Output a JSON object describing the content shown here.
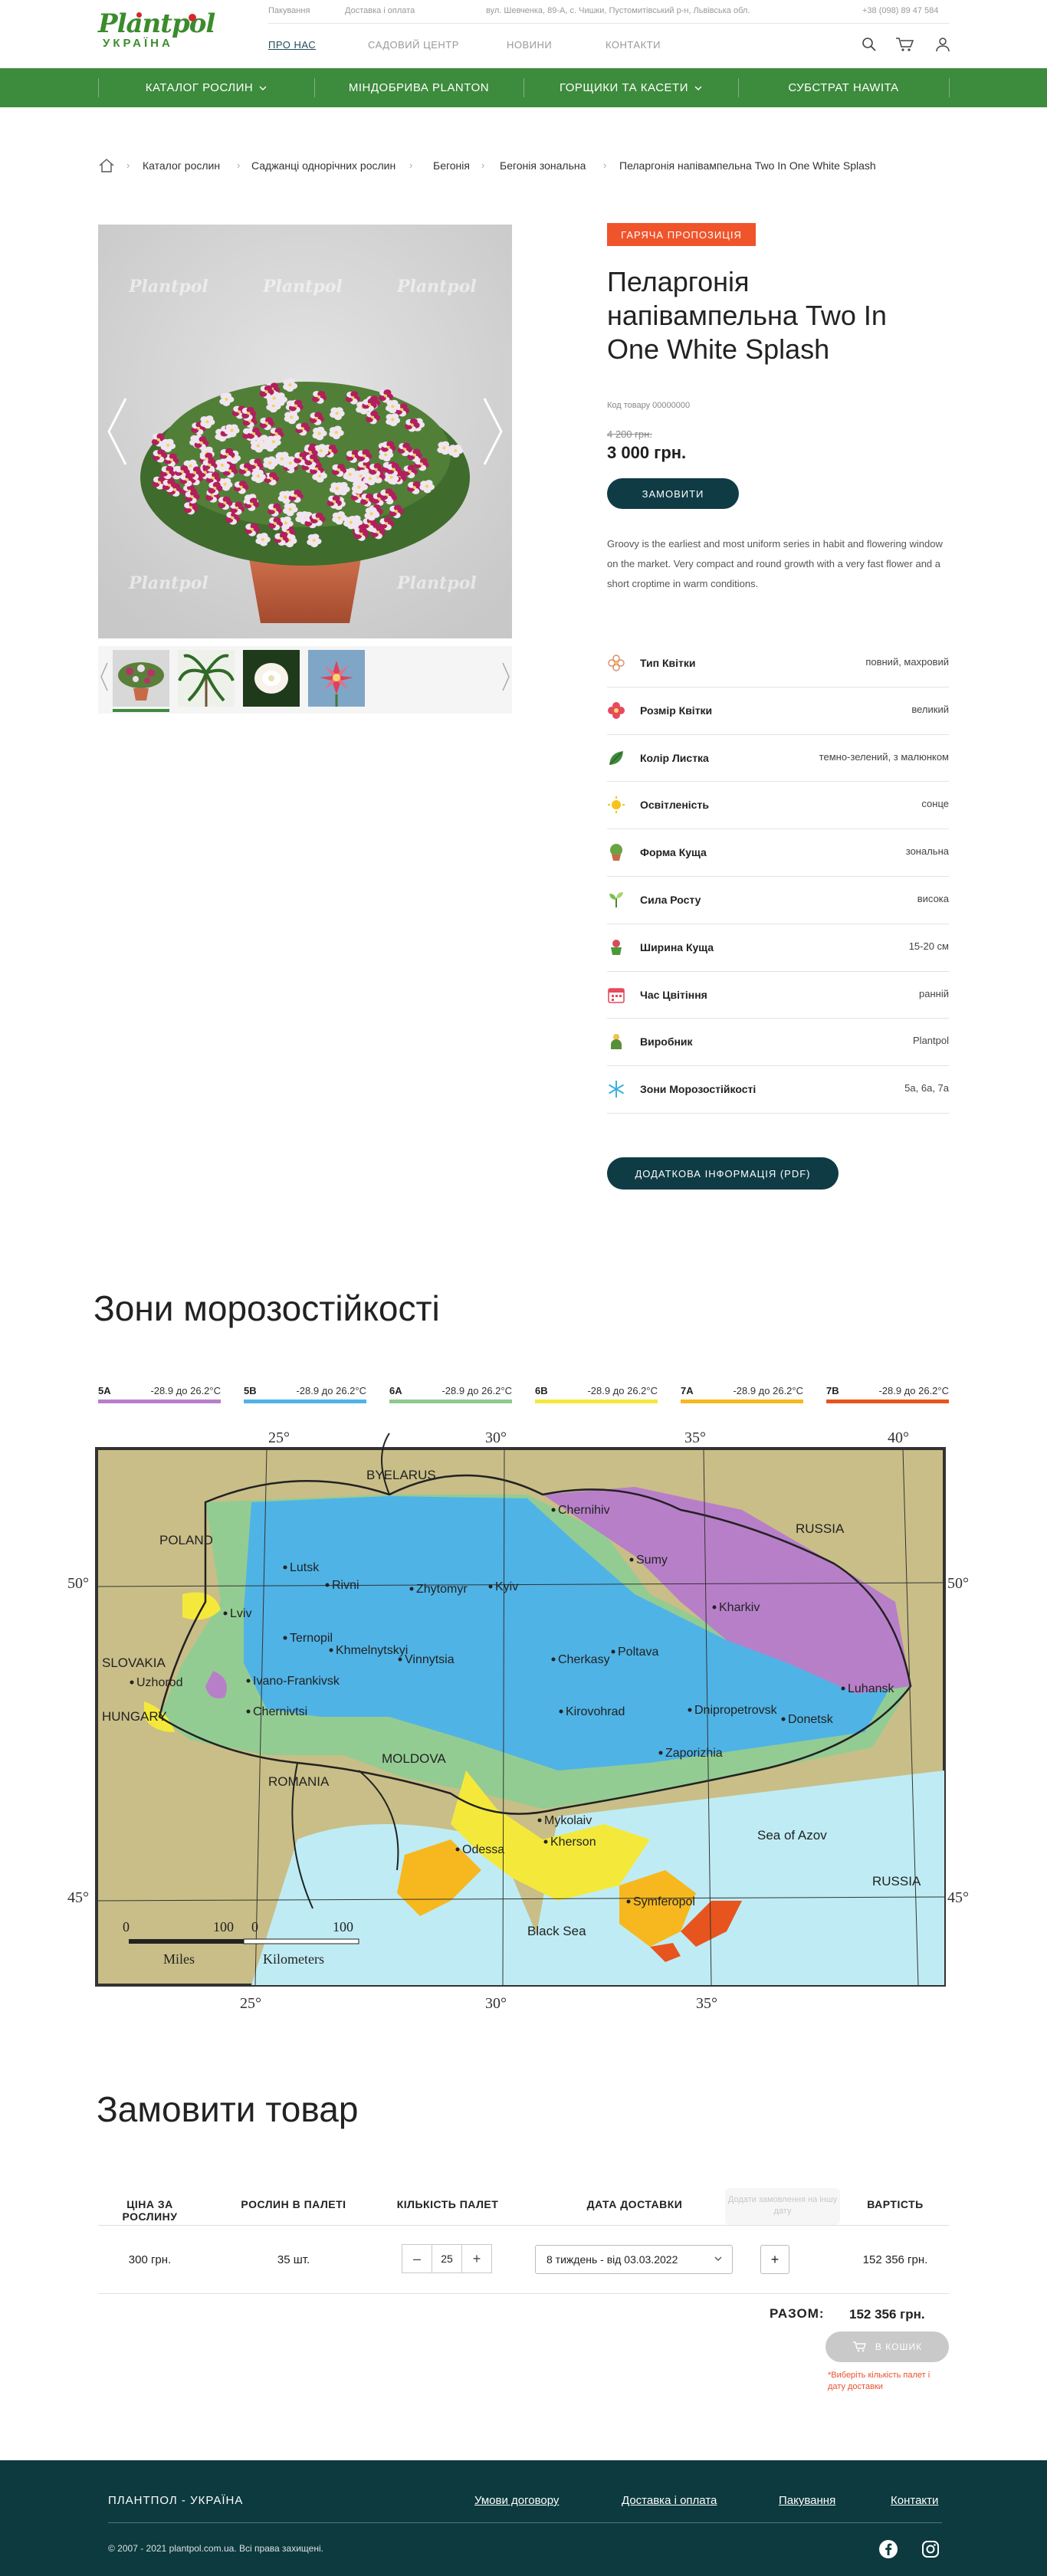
{
  "header": {
    "logo_top": "Plantpol",
    "logo_bottom": "УКРАЇНА",
    "top_links": [
      "Пакування",
      "Доставка і оплата"
    ],
    "address": "вул. Шевченка, 89-А, с. Чишки, Пустомитівський р-н, Львівська обл.",
    "phone": "+38 (098) 89 47 584",
    "main_nav": [
      "ПРО НАС",
      "САДОВИЙ ЦЕНТР",
      "НОВИНИ",
      "КОНТАКТИ"
    ],
    "icons": [
      "search-icon",
      "cart-icon",
      "user-icon"
    ]
  },
  "category_nav": [
    "КАТАЛОГ РОСЛИН",
    "МІНДОБРИВА PLANTON",
    "ГОРЩИКИ ТА КАСЕТИ",
    "СУБСТРАТ HAWITA"
  ],
  "breadcrumb": [
    "Каталог рослин",
    "Саджанці однорічних рослин",
    "Бегонія",
    "Бегонія зональна",
    "Пеларгонія напівампельна Two In One White Splash"
  ],
  "product": {
    "badge": "ГАРЯЧА ПРОПОЗИЦІЯ",
    "title": "Пеларгонія напівампельна Two In One White Splash",
    "sku": "Код товару 00000000",
    "old_price": "4 200 грн.",
    "price": "3 000 грн.",
    "order_button": "ЗАМОВИТИ",
    "description": "Groovy is the earliest and most uniform series in habit and flowering window on the market. Very compact and round growth with a very fast flower and a short croptime in warm conditions.",
    "pdf_button": "ДОДАТКОВА ІНФОРМАЦІЯ (PDF)",
    "watermark": "Plantpol",
    "attributes": [
      {
        "name": "Тип Квітки",
        "value": "повний, махровий",
        "icon": "flower-outline-icon"
      },
      {
        "name": "Розмір Квітки",
        "value": "великий",
        "icon": "flower-red-icon"
      },
      {
        "name": "Колір Листка",
        "value": "темно-зелений, з малюнком",
        "icon": "leaf-icon"
      },
      {
        "name": "Освітленість",
        "value": "сонце",
        "icon": "sun-icon"
      },
      {
        "name": "Форма Куща",
        "value": "зональна",
        "icon": "bush-icon"
      },
      {
        "name": "Сила Росту",
        "value": "висока",
        "icon": "sprout-icon"
      },
      {
        "name": "Ширина Куща",
        "value": "15-20 см",
        "icon": "pot-width-icon"
      },
      {
        "name": "Час Цвітіння",
        "value": "ранній",
        "icon": "calendar-icon"
      },
      {
        "name": "Виробник",
        "value": "Plantpol",
        "icon": "producer-icon"
      },
      {
        "name": "Зони Морозостійкості",
        "value": "5a, 6a, 7a",
        "icon": "snowflake-icon"
      }
    ]
  },
  "zones": {
    "title": "Зони морозостійкості",
    "items": [
      {
        "code": "5A",
        "range": "-28.9 до 26.2°C",
        "color": "#b87fc9"
      },
      {
        "code": "5B",
        "range": "-28.9 до 26.2°C",
        "color": "#4fb3e6"
      },
      {
        "code": "6A",
        "range": "-28.9 до 26.2°C",
        "color": "#8fc98f"
      },
      {
        "code": "6B",
        "range": "-28.9 до 26.2°C",
        "color": "#f4e93a"
      },
      {
        "code": "7A",
        "range": "-28.9 до 26.2°C",
        "color": "#f6b81e"
      },
      {
        "code": "7B",
        "range": "-28.9 до 26.2°C",
        "color": "#e8541e"
      }
    ],
    "map": {
      "lon_labels": [
        "25°",
        "30°",
        "35°",
        "40°"
      ],
      "lat_labels": [
        "50°",
        "45°"
      ],
      "countries": [
        "BYELARUS",
        "POLAND",
        "RUSSIA",
        "SLOVAKIA",
        "HUNGARY",
        "ROMANIA",
        "MOLDOVA",
        "RUSSIA"
      ],
      "cities": [
        "Chernihiv",
        "Sumy",
        "Lutsk",
        "Rivni",
        "Zhytomyr",
        "Kyiv",
        "Kharkiv",
        "Lviv",
        "Ternopil",
        "Khmelnytskyi",
        "Vinnytsia",
        "Poltava",
        "Cherkasy",
        "Uzhorod",
        "Ivano-Frankivsk",
        "Luhansk",
        "Chernivtsi",
        "Kirovohrad",
        "Dnipropetrovsk",
        "Donetsk",
        "Zaporizhia",
        "Mykolaiv",
        "Kherson",
        "Odessa",
        "Symferopol"
      ],
      "seas": [
        "Sea of Azov",
        "Black Sea"
      ],
      "scale": {
        "labels": [
          "0",
          "100",
          "0",
          "100"
        ],
        "units": [
          "Miles",
          "Kilometers"
        ]
      }
    }
  },
  "order": {
    "title": "Замовити товар",
    "headers": [
      "ЦІНА ЗА РОСЛИНУ",
      "РОСЛИН В ПАЛЕТІ",
      "КІЛЬКІСТЬ ПАЛЕТ",
      "ДАТА ДОСТАВКИ",
      "ВАРТІСТЬ"
    ],
    "tooltip": "Додати замовлення на іншу дату",
    "row": {
      "price": "300 грн.",
      "per_pallet": "35 шт.",
      "pallets": "25",
      "date": "8 тиждень - від 03.03.2022",
      "cost": "152 356 грн."
    },
    "total_label": "РАЗОМ:",
    "total_value": "152 356 грн.",
    "cart_button": "В КОШИК",
    "warning": "*Виберіть кількість палет і дату доставки"
  },
  "footer": {
    "brand": "ПЛАНТПОЛ - УКРАЇНА",
    "links": [
      "Умови договору",
      "Доставка і оплата",
      "Пакування",
      "Контакти"
    ],
    "copyright": "© 2007 - 2021 plantpol.com.ua. Всі права захищені."
  }
}
